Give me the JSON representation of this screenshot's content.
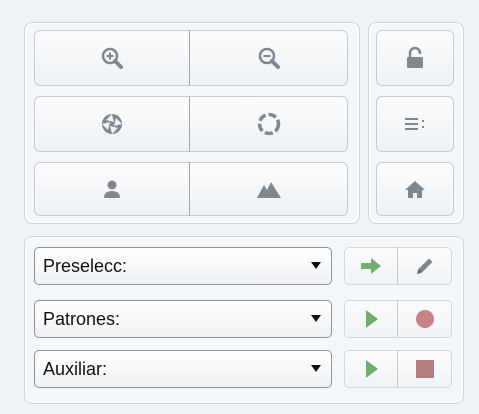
{
  "colors": {
    "icon_gray": "#7f8790",
    "green": "#6fae6f",
    "record_red": "#c98282",
    "stop_red": "#b47d7d"
  },
  "zoom_tools": [
    {
      "icon": "zoom-in-icon"
    },
    {
      "icon": "zoom-out-icon"
    },
    {
      "icon": "aperture-icon"
    },
    {
      "icon": "circle-refresh-icon"
    },
    {
      "icon": "person-icon"
    },
    {
      "icon": "mountain-icon"
    }
  ],
  "side_tools": [
    {
      "icon": "lock-icon"
    },
    {
      "icon": "list-icon"
    },
    {
      "icon": "home-icon"
    }
  ],
  "selectors": [
    {
      "label": "Preselecc:",
      "actions": [
        "arrow-right-icon",
        "pencil-icon"
      ]
    },
    {
      "label": "Patrones:",
      "actions": [
        "play-icon",
        "record-icon"
      ]
    },
    {
      "label": "Auxiliar:",
      "actions": [
        "play-icon",
        "stop-icon"
      ]
    }
  ]
}
